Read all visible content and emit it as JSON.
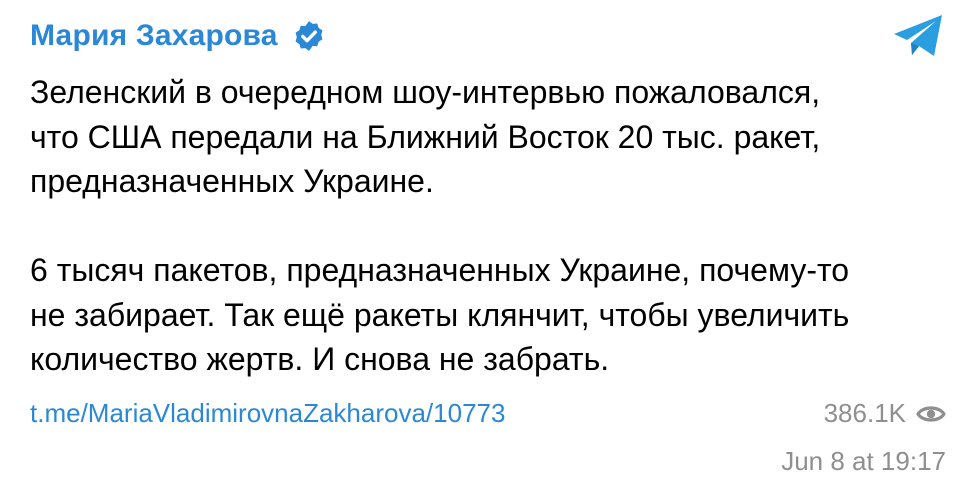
{
  "channel": {
    "author_name": "Мария Захарова",
    "verified": true,
    "accent_color": "#2a88d6"
  },
  "post": {
    "paragraph_1": [
      "Зеленский в очередном шоу-интервью пожаловался,",
      "что США передали на Ближний Восток 20 тыс. ракет,",
      "предназначенных Украине."
    ],
    "paragraph_2": [
      "6 тысяч пакетов, предназначенных Украине, почему-то",
      "не забирает. Так ещё ракеты клянчит, чтобы увеличить",
      "количество жертв. И снова не забрать."
    ],
    "link": "t.me/MariaVladimirovnaZakharova/10773",
    "views": "386.1K",
    "date": "Jun 8 at 19:17"
  },
  "icons": {
    "verified": "verified-badge-icon",
    "telegram": "telegram-logo-icon",
    "views": "eye-icon"
  }
}
